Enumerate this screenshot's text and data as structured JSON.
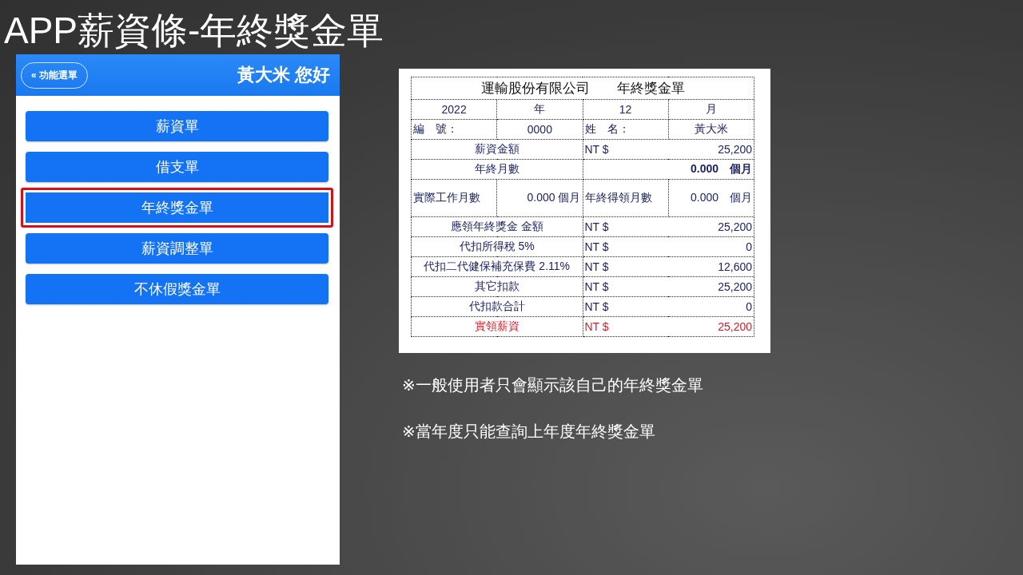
{
  "slide_title": "APP薪資條-年終獎金單",
  "app": {
    "back_button": "« 功能選單",
    "greeting": "黃大米 您好",
    "menu": [
      {
        "label": "薪資單",
        "selected": false
      },
      {
        "label": "借支單",
        "selected": false
      },
      {
        "label": "年終獎金單",
        "selected": true
      },
      {
        "label": "薪資調整單",
        "selected": false
      },
      {
        "label": "不休假獎金單",
        "selected": false
      }
    ]
  },
  "bonus_slip": {
    "title": "運輸股份有限公司　　年終獎金單",
    "rows": [
      {
        "kind": "date",
        "cells": [
          "2022",
          "年",
          "12",
          "月"
        ]
      },
      {
        "kind": "identity",
        "cells": [
          "編　號：",
          "0000",
          "姓　名：",
          "黃大米"
        ]
      },
      {
        "kind": "amount",
        "cells": [
          "薪資金額",
          "NT $",
          "25,200"
        ]
      },
      {
        "kind": "months",
        "cells": [
          "年終月數",
          "",
          "0.000　個月"
        ]
      },
      {
        "kind": "worked",
        "cells": [
          "實際工作月數",
          "0.000 個月",
          "年終得領月數",
          "0.000　個月"
        ]
      },
      {
        "kind": "amount",
        "cells": [
          "應領年終獎金 金額",
          "NT $",
          "25,200"
        ]
      },
      {
        "kind": "amount",
        "cells": [
          "代扣所得稅 5%",
          "NT $",
          "0"
        ]
      },
      {
        "kind": "amount",
        "cells": [
          "代扣二代健保補充保費 2.11%",
          "NT $",
          "12,600"
        ]
      },
      {
        "kind": "amount",
        "cells": [
          "其它扣款",
          "NT $",
          "25,200"
        ]
      },
      {
        "kind": "amount",
        "cells": [
          "代扣款合計",
          "NT $",
          "0"
        ]
      },
      {
        "kind": "total",
        "cells": [
          "實領薪資",
          "NT $",
          "25,200"
        ]
      }
    ]
  },
  "notes": [
    "※一般使用者只會顯示該自己的年終獎金單",
    "※當年度只能查詢上年度年終獎金單"
  ]
}
